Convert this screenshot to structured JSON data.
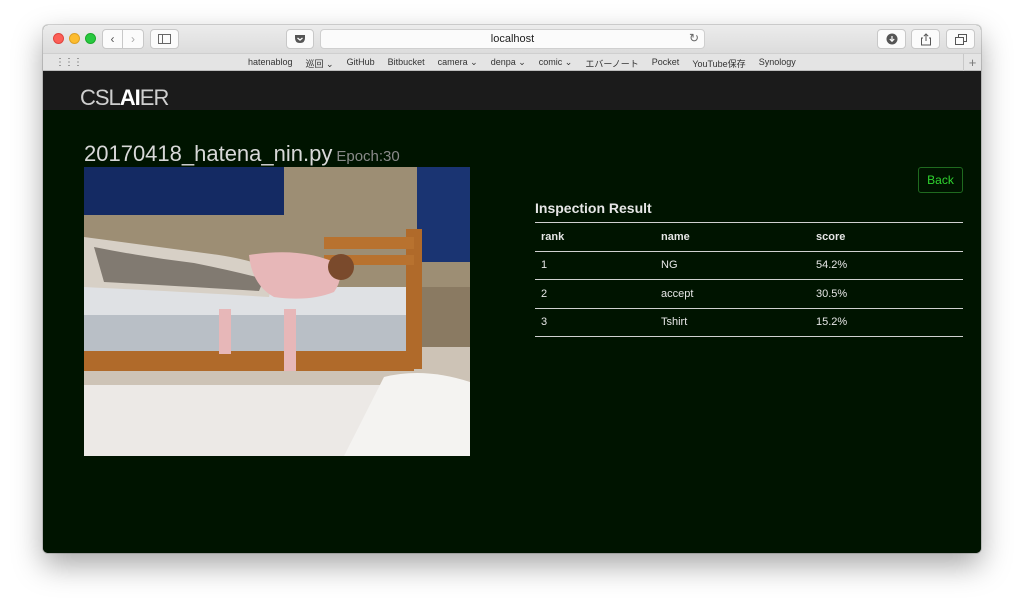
{
  "browser": {
    "address": "localhost",
    "bookmarks": [
      "hatenablog",
      "巡回 ⌄",
      "GitHub",
      "Bitbucket",
      "camera ⌄",
      "denpa ⌄",
      "comic ⌄",
      "エバーノート",
      "Pocket",
      "YouTube保存",
      "Synology"
    ]
  },
  "app": {
    "logo_prefix": "CSL",
    "logo_ai": "AI",
    "logo_suffix": "ER"
  },
  "page": {
    "title": "20170418_hatena_nin.py",
    "epoch": "Epoch:30",
    "back_label": "Back"
  },
  "inspection": {
    "title": "Inspection Result",
    "headers": [
      "rank",
      "name",
      "score"
    ],
    "rows": [
      {
        "rank": "1",
        "name": "NG",
        "score": "54.2%"
      },
      {
        "rank": "2",
        "name": "accept",
        "score": "30.5%"
      },
      {
        "rank": "3",
        "name": "Tshirt",
        "score": "15.2%"
      }
    ]
  },
  "colors": {
    "content_bg": "#001400",
    "appbar_bg": "#1b1b1b",
    "accent_green": "#2fd42f"
  }
}
